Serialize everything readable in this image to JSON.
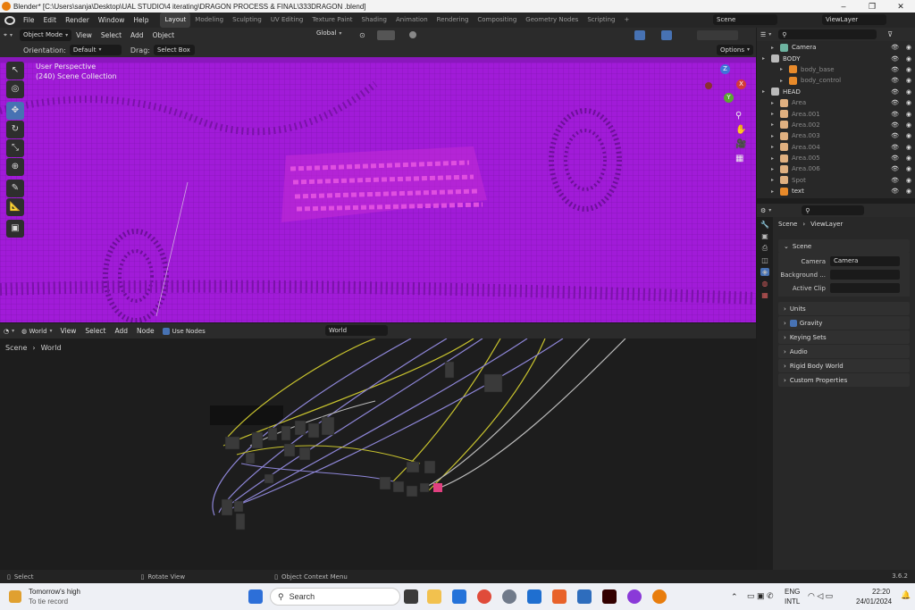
{
  "window": {
    "title": "Blender* [C:\\Users\\sanja\\Desktop\\UAL STUDIO\\4 iterating\\DRAGON PROCESS & FINAL\\333DRAGON .blend]",
    "min": "–",
    "max": "❐",
    "close": "✕"
  },
  "menu": [
    "File",
    "Edit",
    "Render",
    "Window",
    "Help"
  ],
  "workspaces": [
    "Layout",
    "Modeling",
    "Sculpting",
    "UV Editing",
    "Texture Paint",
    "Shading",
    "Animation",
    "Rendering",
    "Compositing",
    "Geometry Nodes",
    "Scripting"
  ],
  "workspace_add": "+",
  "scene_field": "Scene",
  "viewlayer_field": "ViewLayer",
  "view3d": {
    "mode": "Object Mode",
    "view": "View",
    "select": "Select",
    "add": "Add",
    "object": "Object",
    "orientation_label": "Orientation:",
    "orientation": "Default",
    "drag_label": "Drag:",
    "drag": "Select Box",
    "transform": "Global",
    "options": "Options",
    "overlay_line1": "User Perspective",
    "overlay_line2": "(240) Scene Collection",
    "gizmo_x": "X",
    "gizmo_y": "Y",
    "gizmo_z": "Z"
  },
  "nodeeditor": {
    "type": "World",
    "view": "View",
    "select": "Select",
    "add": "Add",
    "node": "Node",
    "use_nodes": "Use Nodes",
    "world_field": "World",
    "crumb_scene": "Scene",
    "crumb_world": "World"
  },
  "outliner": {
    "rows": [
      {
        "label": "Camera",
        "indent": 1,
        "dim": false,
        "color": "#6db3a0"
      },
      {
        "label": "BODY",
        "indent": 0,
        "dim": false,
        "color": "#bbb"
      },
      {
        "label": "body_base",
        "indent": 2,
        "dim": true,
        "color": "#e88a2a"
      },
      {
        "label": "body_control",
        "indent": 2,
        "dim": true,
        "color": "#e88a2a"
      },
      {
        "label": "HEAD",
        "indent": 0,
        "dim": false,
        "color": "#bbb"
      },
      {
        "label": "Area",
        "indent": 1,
        "dim": true,
        "color": "#e0b080"
      },
      {
        "label": "Area.001",
        "indent": 1,
        "dim": true,
        "color": "#e0b080"
      },
      {
        "label": "Area.002",
        "indent": 1,
        "dim": true,
        "color": "#e0b080"
      },
      {
        "label": "Area.003",
        "indent": 1,
        "dim": true,
        "color": "#e0b080"
      },
      {
        "label": "Area.004",
        "indent": 1,
        "dim": true,
        "color": "#e0b080"
      },
      {
        "label": "Area.005",
        "indent": 1,
        "dim": true,
        "color": "#e0b080"
      },
      {
        "label": "Area.006",
        "indent": 1,
        "dim": true,
        "color": "#e0b080"
      },
      {
        "label": "Spot",
        "indent": 1,
        "dim": true,
        "color": "#e0b080"
      },
      {
        "label": "text",
        "indent": 1,
        "dim": false,
        "color": "#e88a2a"
      }
    ]
  },
  "properties": {
    "crumb_scene": "Scene",
    "crumb_viewlayer": "ViewLayer",
    "section": "Scene",
    "camera_label": "Camera",
    "camera_value": "Camera",
    "background_label": "Background ...",
    "activeclip_label": "Active Clip",
    "panels": [
      "Units",
      "Gravity",
      "Keying Sets",
      "Audio",
      "Rigid Body World",
      "Custom Properties"
    ]
  },
  "status": {
    "select": "Select",
    "rotate": "Rotate View",
    "context": "Object Context Menu",
    "version": "3.6.2"
  },
  "taskbar": {
    "weather_line1": "Tomorrow's high",
    "weather_line2": "To tie record",
    "search": "Search",
    "lang1": "ENG",
    "lang2": "INTL",
    "time": "22:20",
    "date": "24/01/2024"
  },
  "colors": {
    "viewport": "#a019d8",
    "accent": "#4772b3"
  }
}
